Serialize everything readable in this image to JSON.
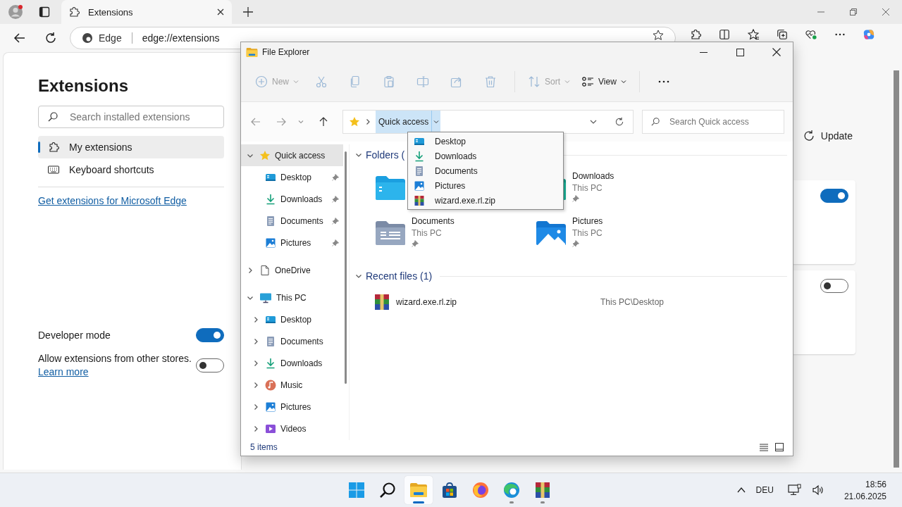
{
  "browser": {
    "tab": {
      "title": "Extensions"
    },
    "site_label": "Edge",
    "url": "edge://extensions"
  },
  "extensions_page": {
    "title": "Extensions",
    "search": {
      "placeholder": "Search installed extensions"
    },
    "nav": [
      {
        "kind": "puzzle",
        "label": "My extensions",
        "selected": true
      },
      {
        "kind": "keyboard",
        "label": "Keyboard shortcuts",
        "selected": false
      }
    ],
    "get_link": "Get extensions for Microsoft Edge",
    "developer_mode": {
      "label": "Developer mode",
      "on": true
    },
    "other_stores": {
      "label": "Allow extensions from other stores.",
      "link": "Learn more",
      "on": false
    },
    "update_button": "Update",
    "cards": [
      {
        "on": true
      },
      {
        "on": false
      }
    ]
  },
  "file_explorer": {
    "title": "File Explorer",
    "toolbar": [
      {
        "kind": "new",
        "label": "New",
        "disabled": true
      },
      {
        "kind": "cut",
        "disabled": true
      },
      {
        "kind": "copy",
        "disabled": true
      },
      {
        "kind": "paste",
        "disabled": true
      },
      {
        "kind": "rename",
        "disabled": true
      },
      {
        "kind": "share",
        "disabled": true
      },
      {
        "kind": "delete",
        "disabled": true
      },
      {
        "kind": "sort",
        "label": "Sort",
        "disabled": true
      },
      {
        "kind": "view",
        "label": "View",
        "disabled": false
      },
      {
        "kind": "more",
        "disabled": false
      }
    ],
    "address": {
      "location": "Quick access",
      "menu_open": true
    },
    "search": {
      "placeholder": "Search Quick access"
    },
    "location_menu": [
      {
        "kind": "desktop",
        "label": "Desktop"
      },
      {
        "kind": "downloads",
        "label": "Downloads"
      },
      {
        "kind": "documents",
        "label": "Documents"
      },
      {
        "kind": "pictures",
        "label": "Pictures"
      },
      {
        "kind": "archive",
        "label": "wizard.exe.rl.zip"
      }
    ],
    "nav": [
      {
        "kind": "star",
        "label": "Quick access",
        "expanded": true,
        "selected": true,
        "children": [
          {
            "kind": "desktop",
            "label": "Desktop",
            "pinned": true
          },
          {
            "kind": "downloads",
            "label": "Downloads",
            "pinned": true
          },
          {
            "kind": "documents",
            "label": "Documents",
            "pinned": true
          },
          {
            "kind": "pictures",
            "label": "Pictures",
            "pinned": true
          }
        ]
      },
      {
        "kind": "onedrive",
        "label": "OneDrive",
        "expanded": false,
        "selected": false
      },
      {
        "kind": "pc",
        "label": "This PC",
        "expanded": true,
        "selected": false,
        "children": [
          {
            "kind": "desktop",
            "label": "Desktop",
            "expanded": false
          },
          {
            "kind": "documents",
            "label": "Documents",
            "expanded": false
          },
          {
            "kind": "downloads",
            "label": "Downloads",
            "expanded": false
          },
          {
            "kind": "music",
            "label": "Music",
            "expanded": false
          },
          {
            "kind": "pictures",
            "label": "Pictures",
            "expanded": false
          },
          {
            "kind": "videos",
            "label": "Videos",
            "expanded": false
          }
        ]
      }
    ],
    "folders_heading": "Folders (",
    "folders": [
      {
        "kind": "desktop"
      },
      {
        "kind": "downloads",
        "name": "Downloads",
        "location": "This PC",
        "pinned": true
      },
      {
        "kind": "documents",
        "name": "Documents",
        "location": "This PC",
        "pinned": true
      },
      {
        "kind": "pictures",
        "name": "Pictures",
        "location": "This PC",
        "pinned": true
      }
    ],
    "recent_heading": "Recent files (1)",
    "recent_files": [
      {
        "kind": "archive",
        "name": "wizard.exe.rl.zip",
        "location": "This PC\\Desktop"
      }
    ],
    "status": "5 items"
  },
  "taskbar": {
    "apps": [
      {
        "kind": "start",
        "open": false,
        "active": false
      },
      {
        "kind": "search",
        "open": false,
        "active": false
      },
      {
        "kind": "explorer",
        "open": true,
        "active": true
      },
      {
        "kind": "store",
        "open": false,
        "active": false
      },
      {
        "kind": "firefox",
        "open": false,
        "active": false
      },
      {
        "kind": "edge",
        "open": true,
        "active": false
      },
      {
        "kind": "winrar",
        "open": true,
        "active": false
      }
    ],
    "language": "DEU",
    "time": "18:56",
    "date": "21.06.2025"
  }
}
